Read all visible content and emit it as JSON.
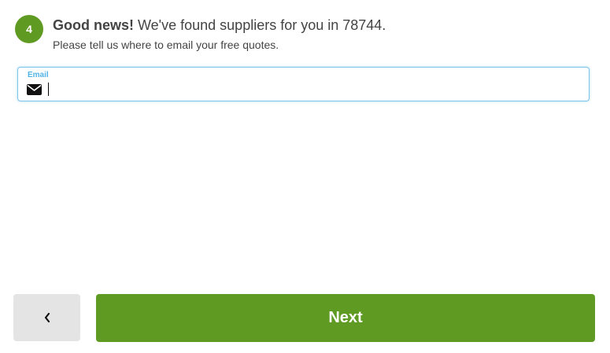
{
  "step": {
    "number": "4"
  },
  "header": {
    "headline_strong": "Good news!",
    "headline_rest": " We've found suppliers for you in 78744.",
    "subtitle": "Please tell us where to email your free quotes."
  },
  "email_field": {
    "label": "Email",
    "value": "",
    "icon": "envelope-icon"
  },
  "buttons": {
    "back_icon": "chevron-left-icon",
    "next_label": "Next"
  },
  "colors": {
    "accent_green": "#5f9a22",
    "focus_blue": "#7cc4ea",
    "label_blue": "#4fb3e8",
    "back_button_gray": "#e4e4e4"
  }
}
